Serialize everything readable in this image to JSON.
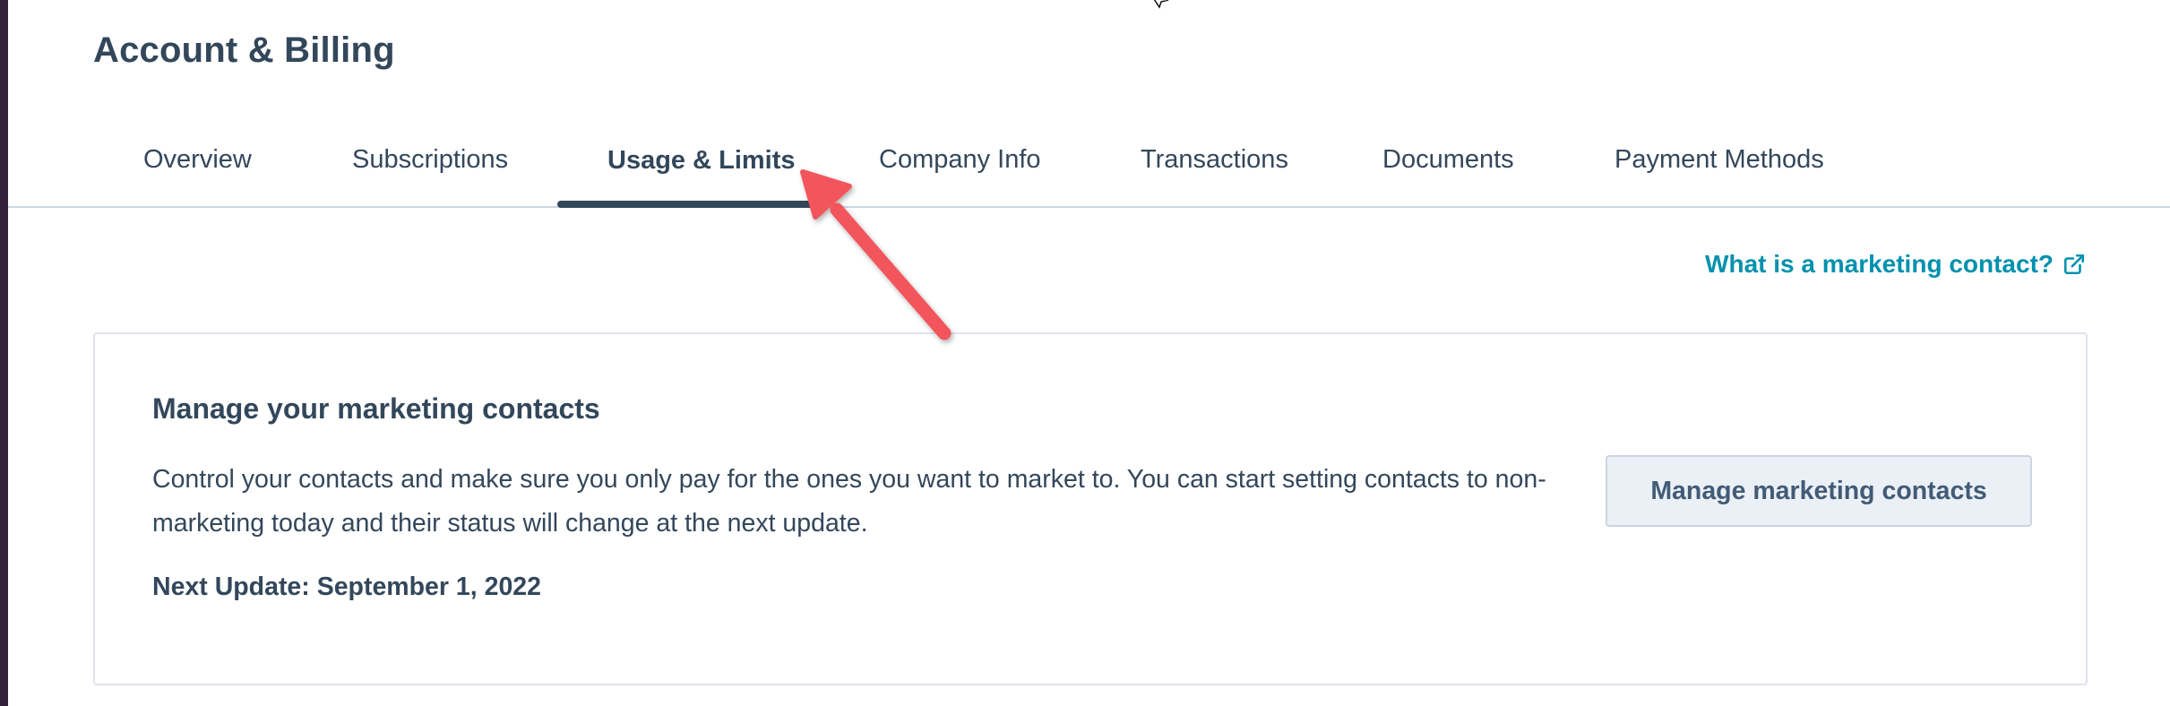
{
  "header": {
    "title": "Account & Billing"
  },
  "tabs": [
    {
      "label": "Overview",
      "active": false
    },
    {
      "label": "Subscriptions",
      "active": false
    },
    {
      "label": "Usage & Limits",
      "active": true
    },
    {
      "label": "Company Info",
      "active": false
    },
    {
      "label": "Transactions",
      "active": false
    },
    {
      "label": "Documents",
      "active": false
    },
    {
      "label": "Payment Methods",
      "active": false
    }
  ],
  "help_link": {
    "label": "What is a marketing contact?",
    "icon": "external-link-icon"
  },
  "card": {
    "title": "Manage your marketing contacts",
    "description": "Control your contacts and make sure you only pay for the ones you want to market to. You can start setting contacts to non-marketing today and their status will change at the next update.",
    "next_update": "Next Update: September 1, 2022",
    "button_label": "Manage marketing contacts"
  },
  "annotation": {
    "icon": "red-arrow-icon"
  },
  "colors": {
    "text": "#33475b",
    "link": "#0091ae",
    "button_bg": "#eaf0f6",
    "button_border": "#cbd6e2",
    "arrow": "#f2545b",
    "left_strip": "#33213a"
  }
}
